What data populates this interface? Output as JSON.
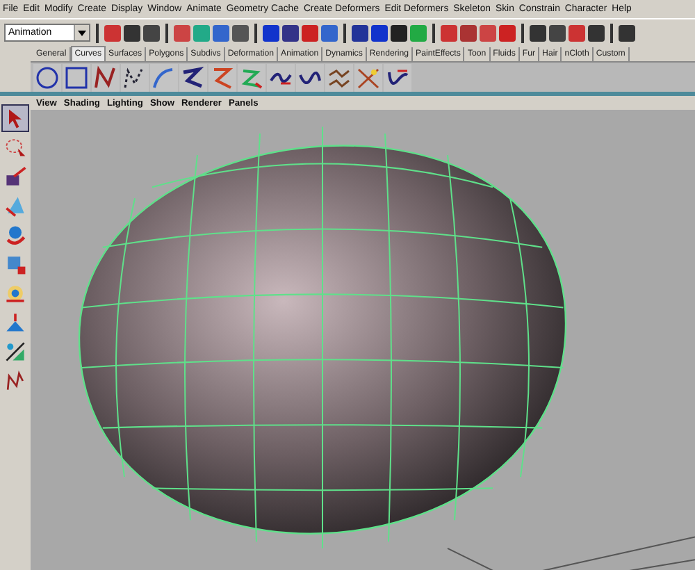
{
  "menu_bar": [
    "File",
    "Edit",
    "Modify",
    "Create",
    "Display",
    "Window",
    "Animate",
    "Geometry Cache",
    "Create Deformers",
    "Edit Deformers",
    "Skeleton",
    "Skin",
    "Constrain",
    "Character",
    "Help"
  ],
  "status_line": {
    "menu_set": "Animation"
  },
  "shelf_tabs": [
    {
      "label": "General",
      "selected": false
    },
    {
      "label": "Curves",
      "selected": true
    },
    {
      "label": "Surfaces",
      "selected": false
    },
    {
      "label": "Polygons",
      "selected": false
    },
    {
      "label": "Subdivs",
      "selected": false
    },
    {
      "label": "Deformation",
      "selected": false
    },
    {
      "label": "Animation",
      "selected": false
    },
    {
      "label": "Dynamics",
      "selected": false
    },
    {
      "label": "Rendering",
      "selected": false
    },
    {
      "label": "PaintEffects",
      "selected": false
    },
    {
      "label": "Toon",
      "selected": false
    },
    {
      "label": "Fluids",
      "selected": false
    },
    {
      "label": "Fur",
      "selected": false
    },
    {
      "label": "Hair",
      "selected": false
    },
    {
      "label": "nCloth",
      "selected": false
    },
    {
      "label": "Custom",
      "selected": false
    }
  ],
  "toolbox": [
    {
      "kind": "select",
      "selected": true
    },
    {
      "kind": "lasso",
      "selected": false
    },
    {
      "kind": "paint",
      "selected": false
    },
    {
      "kind": "move",
      "selected": false
    },
    {
      "kind": "rotate",
      "selected": false
    },
    {
      "kind": "scale",
      "selected": false
    },
    {
      "kind": "manip",
      "selected": false
    },
    {
      "kind": "soft",
      "selected": false
    },
    {
      "kind": "last",
      "selected": false
    },
    {
      "kind": "curve",
      "selected": false
    }
  ],
  "panel_menu": [
    "View",
    "Shading",
    "Lighting",
    "Show",
    "Renderer",
    "Panels"
  ]
}
